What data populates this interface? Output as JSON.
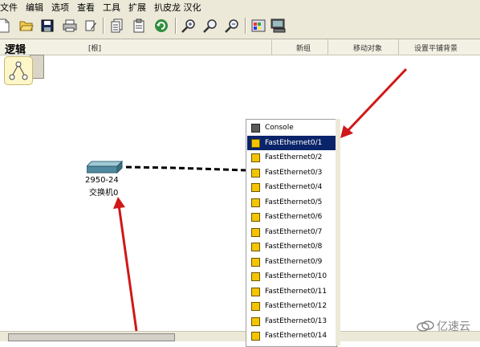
{
  "menubar": {
    "items": [
      "文件",
      "编辑",
      "选项",
      "查看",
      "工具",
      "扩展",
      "扒皮龙 汉化"
    ]
  },
  "toolbar": {
    "icons": [
      "new-file-icon",
      "open-folder-icon",
      "save-icon",
      "print-icon",
      "edit-icon",
      "copy-icon",
      "paste-icon",
      "undo-icon",
      "zoom-in-icon",
      "zoom-reset-icon",
      "zoom-out-icon",
      "palette-icon",
      "custom-device-icon"
    ]
  },
  "logicbar": {
    "title": "逻辑",
    "root": "[根]",
    "new_cluster": "新组",
    "move_object": "移动对象",
    "set_background": "设置平铺背景"
  },
  "device": {
    "model": "2950-24",
    "name": "交换机0"
  },
  "port_menu": {
    "items": [
      "Console",
      "FastEthernet0/1",
      "FastEthernet0/2",
      "FastEthernet0/3",
      "FastEthernet0/4",
      "FastEthernet0/5",
      "FastEthernet0/6",
      "FastEthernet0/7",
      "FastEthernet0/8",
      "FastEthernet0/9",
      "FastEthernet0/10",
      "FastEthernet0/11",
      "FastEthernet0/12",
      "FastEthernet0/13",
      "FastEthernet0/14"
    ],
    "selected": "FastEthernet0/1"
  },
  "watermark": {
    "text": "亿速云"
  },
  "colors": {
    "selected_bg": "#0a246a",
    "arrow": "#d01818",
    "port_icon": "#f4c400"
  }
}
